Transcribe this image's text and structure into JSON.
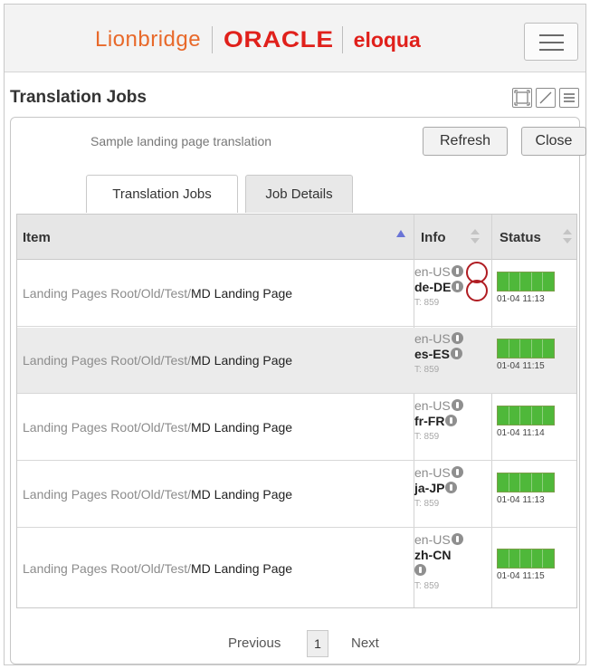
{
  "header": {
    "brand": {
      "lionbridge": "Lionbridge",
      "oracle": "ORACLE",
      "eloqua": "eloqua"
    },
    "menu_icon": "hamburger-menu-icon"
  },
  "page": {
    "title": "Translation Jobs",
    "tools": [
      "maximize-icon",
      "expand-diagonal-icon",
      "list-menu-icon"
    ]
  },
  "panel": {
    "job_name": "Sample landing page translation",
    "refresh_label": "Refresh",
    "close_label": "Close",
    "tabs": [
      {
        "label": "Translation Jobs",
        "active": true
      },
      {
        "label": "Job Details",
        "active": false
      }
    ]
  },
  "table": {
    "columns": [
      "Item",
      "Info",
      "Status"
    ],
    "rows": [
      {
        "path": "Landing Pages Root/Old/Test/",
        "name": "MD Landing Page",
        "source": "en-US",
        "target": "de-DE",
        "tnum": "T: 859",
        "status_time": "01-04 11:13",
        "progress": 1.0
      },
      {
        "path": "Landing Pages Root/Old/Test/",
        "name": "MD Landing Page",
        "source": "en-US",
        "target": "es-ES",
        "tnum": "T: 859",
        "status_time": "01-04 11:15",
        "progress": 1.0
      },
      {
        "path": "Landing Pages Root/Old/Test/",
        "name": "MD Landing Page",
        "source": "en-US",
        "target": "fr-FR",
        "tnum": "T: 859",
        "status_time": "01-04 11:14",
        "progress": 1.0
      },
      {
        "path": "Landing Pages Root/Old/Test/",
        "name": "MD Landing Page",
        "source": "en-US",
        "target": "ja-JP",
        "tnum": "T: 859",
        "status_time": "01-04 11:13",
        "progress": 1.0
      },
      {
        "path": "Landing Pages Root/Old/Test/",
        "name": "MD Landing Page",
        "source": "en-US",
        "target": "zh-CN",
        "tnum": "T: 859",
        "status_time": "01-04 11:15",
        "progress": 1.0
      }
    ]
  },
  "pager": {
    "previous_label": "Previous",
    "current_page": "1",
    "next_label": "Next"
  },
  "colors": {
    "brand_orange": "#e8692a",
    "oracle_red": "#e0201b",
    "progress_green": "#4fb83a",
    "highlight_red": "#b01c22"
  }
}
